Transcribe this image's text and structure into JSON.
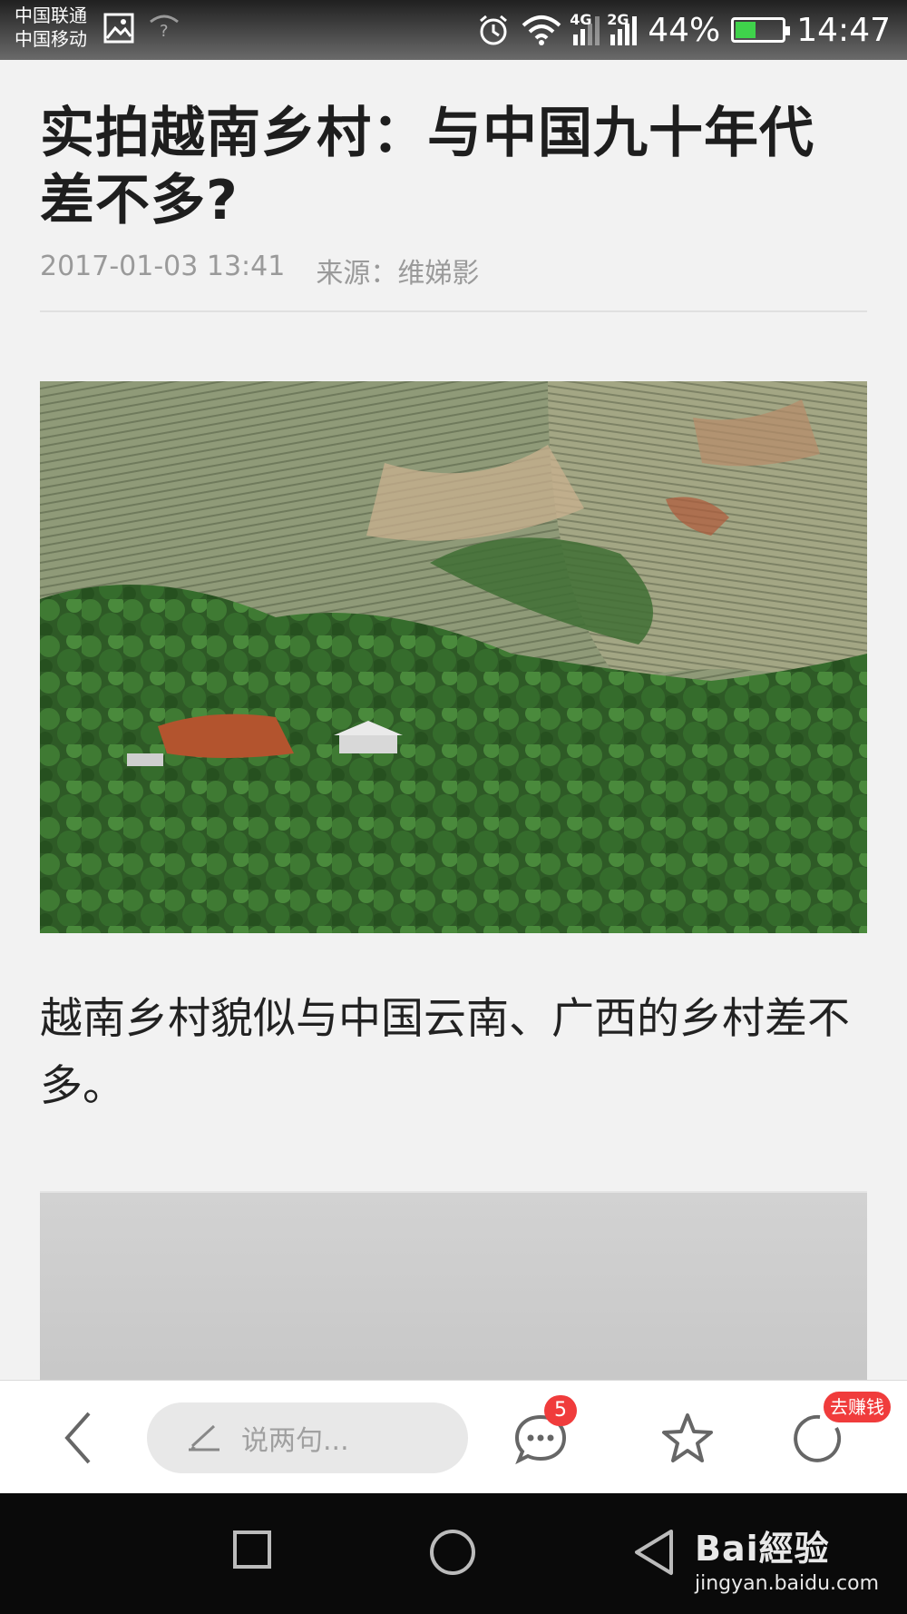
{
  "status_bar": {
    "carrier_1": "中国联通",
    "carrier_2": "中国移动",
    "network_1": "4G",
    "network_2": "2G",
    "battery_percent": "44%",
    "battery_level": 0.44,
    "time": "14:47"
  },
  "article": {
    "title": "实拍越南乡村：与中国九十年代差不多?",
    "date": "2017-01-03 13:41",
    "source": "来源：维娣影",
    "paragraph": "越南乡村貌似与中国云南、广西的乡村差不多。"
  },
  "toolbar": {
    "comment_placeholder": "说两句...",
    "comment_count": "5",
    "earn_badge": "去赚钱"
  },
  "watermark": {
    "brand": "Bai經验",
    "url": "jingyan.baidu.com"
  },
  "colors": {
    "badge": "#f03c3c",
    "battery": "#3fd24b"
  }
}
